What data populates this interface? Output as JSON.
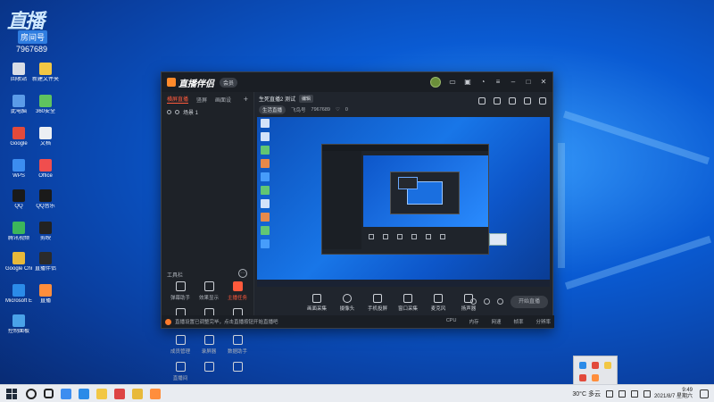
{
  "overlay": {
    "logo": "直播",
    "tag": "房间号",
    "id_line": "7967689"
  },
  "desktop_icons": [
    {
      "label": "回收站",
      "color": "#d8dde6"
    },
    {
      "label": "新建文件夹",
      "color": "#f2c744"
    },
    {
      "label": "此电脑",
      "color": "#5b9be8"
    },
    {
      "label": "360安全",
      "color": "#5fc35f"
    },
    {
      "label": "Google",
      "color": "#e24a3b"
    },
    {
      "label": "文档",
      "color": "#eceff3"
    },
    {
      "label": "WPS",
      "color": "#3c8df0"
    },
    {
      "label": "Office",
      "color": "#f04e4e"
    },
    {
      "label": "QQ",
      "color": "#1a1a1a"
    },
    {
      "label": "QQ音乐",
      "color": "#1a1a1a"
    },
    {
      "label": "腾讯视频",
      "color": "#3cb65b"
    },
    {
      "label": "剪映",
      "color": "#222"
    },
    {
      "label": "Google Chrome",
      "color": "#e8b93a"
    },
    {
      "label": "直播伴侣",
      "color": "#2b2b2b"
    },
    {
      "label": "Microsoft Edge",
      "color": "#2b8be8"
    },
    {
      "label": "直播",
      "color": "#ff8e3c"
    },
    {
      "label": "控制面板",
      "color": "#4aa2e8"
    }
  ],
  "app": {
    "logo": "直播伴侣",
    "version_badge": "会员",
    "left_tabs": [
      "横屏直播",
      "竖屏",
      "画面设"
    ],
    "scene_label": "场景 1",
    "tools_header": "工具栏",
    "tools": [
      {
        "label": "弹幕助手",
        "hot": false
      },
      {
        "label": "效果显示",
        "hot": false
      },
      {
        "label": "主播任务",
        "hot": true
      },
      {
        "label": "福袋设置",
        "hot": false
      },
      {
        "label": "多人直播",
        "hot": false
      },
      {
        "label": "连线申请",
        "hot": false
      },
      {
        "label": "成员管理",
        "hot": false
      },
      {
        "label": "录屏器",
        "hot": false
      },
      {
        "label": "数据助手",
        "hot": false
      },
      {
        "label": "直播间",
        "hot": false
      },
      {
        "label": "",
        "hot": false
      },
      {
        "label": "",
        "hot": false
      }
    ],
    "room_title": "生死直播2 测试",
    "room_edit": "编辑",
    "room_category": "生活直播",
    "room_fans": "飞鸟号",
    "room_id": "7967689",
    "room_likes": "0",
    "bottom_tools": [
      "画面采集",
      "摄像头",
      "手机投屏",
      "窗口采集",
      "麦克风",
      "扬声器"
    ],
    "go_live": "开始直播",
    "status_left": "直播设置已调整完毕，点击直播按钮开始直播吧",
    "status_right": [
      "CPU",
      "内存",
      "网速",
      "帧率",
      "分辨率"
    ]
  },
  "taskbar": {
    "icons": [
      "#3c8df0",
      "#2b8be8",
      "#f2c744",
      "#d44",
      "#e8b93a",
      "#ff8e3c"
    ],
    "weather": "30°C 多云",
    "time": "9:49",
    "date": "2021/8/7 星期六"
  }
}
